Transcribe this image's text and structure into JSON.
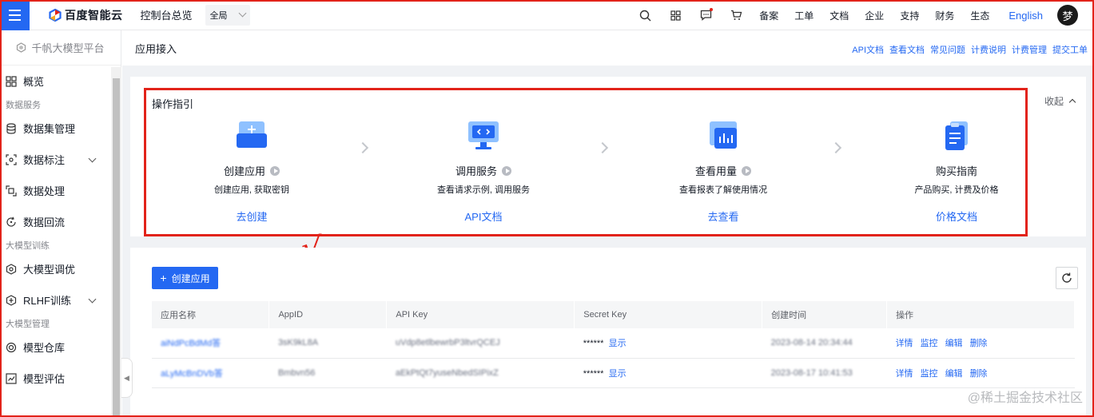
{
  "topbar": {
    "logo_text": "百度智能云",
    "console_label": "控制台总览",
    "region": "全局",
    "nav_links": [
      "备案",
      "工单",
      "文档",
      "企业",
      "支持",
      "财务",
      "生态"
    ],
    "language": "English",
    "avatar_text": "梦"
  },
  "sidebar": {
    "platform": "千帆大模型平台",
    "overview": "概览",
    "group_data": "数据服务",
    "dataset": "数据集管理",
    "annotation": "数据标注",
    "processing": "数据处理",
    "reflow": "数据回流",
    "group_train": "大模型训练",
    "tuning": "大模型调优",
    "rlhf": "RLHF训练",
    "group_manage": "大模型管理",
    "repository": "模型仓库",
    "evaluation": "模型评估"
  },
  "page": {
    "title": "应用接入",
    "doc_links": [
      "API文档",
      "查看文档",
      "常见问题",
      "计费说明",
      "计费管理",
      "提交工单"
    ]
  },
  "guide": {
    "title": "操作指引",
    "collapse": "收起",
    "annotation_mark": "√",
    "steps": [
      {
        "name": "创建应用",
        "desc": "创建应用, 获取密钥",
        "link": "去创建"
      },
      {
        "name": "调用服务",
        "desc": "查看请求示例, 调用服务",
        "link": "API文档"
      },
      {
        "name": "查看用量",
        "desc": "查看报表了解使用情况",
        "link": "去查看"
      },
      {
        "name": "购买指南",
        "desc": "产品购买, 计费及价格",
        "link": "价格文档"
      }
    ]
  },
  "apps": {
    "create_button": "创建应用",
    "columns": [
      "应用名称",
      "AppID",
      "API Key",
      "Secret Key",
      "创建时间",
      "操作"
    ],
    "rows": [
      {
        "name": "aiNdPcBdMd答",
        "appid": "3sK9kL8A",
        "apikey": "uVdp8etlbewrbP3ltvrQCEJ",
        "secret": "******",
        "show": "显示",
        "date": "2023-08-14 20:34:44",
        "ops": [
          "详情",
          "监控",
          "编辑",
          "删除"
        ]
      },
      {
        "name": "aLyMcBnDVb答",
        "appid": "Bmbvn56",
        "apikey": "aEkPtQt7yuseNbedSIPixZ",
        "secret": "******",
        "show": "显示",
        "date": "2023-08-17 10:41:53",
        "ops": [
          "详情",
          "监控",
          "编辑",
          "删除"
        ]
      }
    ]
  },
  "watermark": "@稀土掘金技术社区"
}
